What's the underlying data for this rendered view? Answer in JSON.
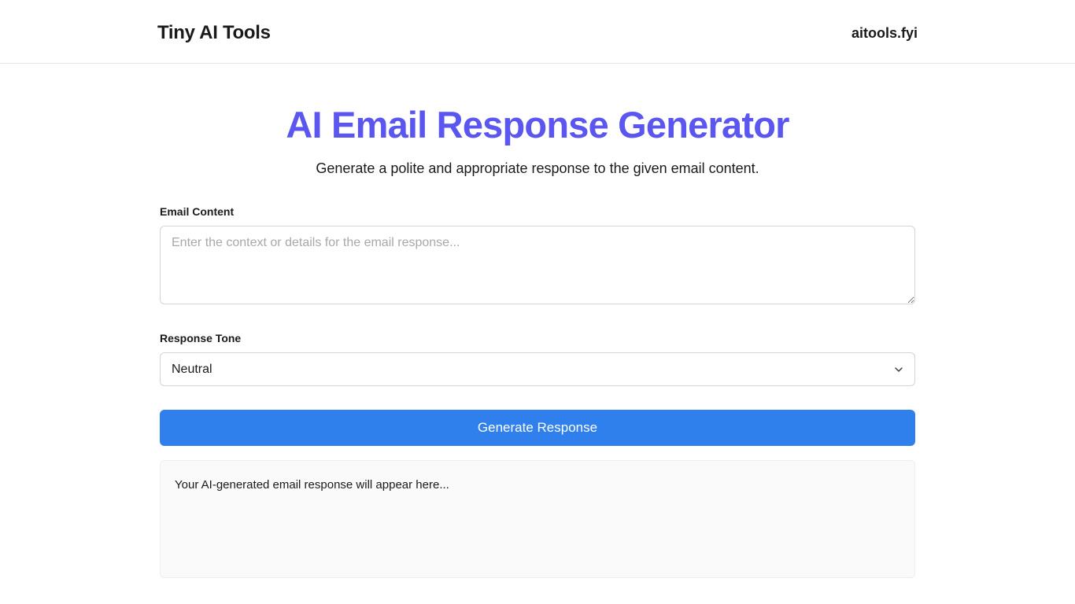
{
  "header": {
    "title": "Tiny AI Tools",
    "link": "aitools.fyi"
  },
  "main": {
    "title": "AI Email Response Generator",
    "subtitle": "Generate a polite and appropriate response to the given email content."
  },
  "form": {
    "email_content": {
      "label": "Email Content",
      "placeholder": "Enter the context or details for the email response..."
    },
    "response_tone": {
      "label": "Response Tone",
      "selected": "Neutral"
    },
    "generate_button": "Generate Response"
  },
  "output": {
    "placeholder_text": "Your AI-generated email response will appear here..."
  }
}
